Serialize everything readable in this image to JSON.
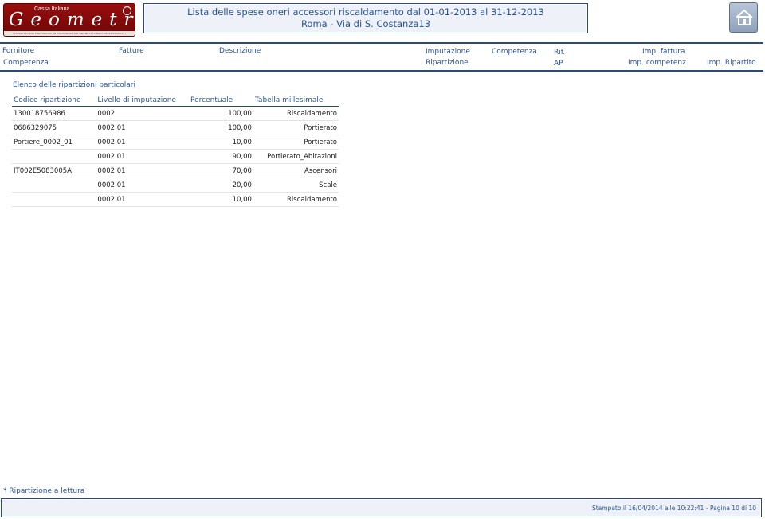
{
  "logo": {
    "top_text": "Cassa Italiana",
    "word": "Geometri",
    "sub_text": "CASSA ITALIANA PREVIDENZA ED ASSISTENZA DEI GEOMETRI LIBERI PROFESSIONISTI"
  },
  "report": {
    "title_line1": "Lista delle spese oneri accessori riscaldamento dal 01-01-2013 al 31-12-2013",
    "title_line2": "Roma - Via di S. Costanza13"
  },
  "columns": {
    "fornitore": "Fornitore",
    "fatture": "Fatture",
    "descrizione": "Descrizione",
    "imputazione": "Imputazione",
    "competenza_top": "Competenza",
    "rif": "Rif.",
    "imp_fattura": "Imp. fattura",
    "competenza_left": "Competenza",
    "ripartizione": "Ripartizione",
    "ap": "AP",
    "imp_competenz": "Imp. competenz",
    "imp_ripartito": "Imp. Ripartito"
  },
  "section": {
    "title": "Elenco delle ripartizioni particolari",
    "headers": [
      "Codice ripartizione",
      "Livello di imputazione",
      "Percentuale",
      "Tabella millesimale"
    ],
    "rows": [
      {
        "codice": "130018756986",
        "livello": "0002",
        "percentuale": "100,00",
        "tabella": "Riscaldamento"
      },
      {
        "codice": "0686329075",
        "livello": "0002 01",
        "percentuale": "100,00",
        "tabella": "Portierato"
      },
      {
        "codice": "Portiere_0002_01",
        "livello": "0002 01",
        "percentuale": "10,00",
        "tabella": "Portierato"
      },
      {
        "codice": "",
        "livello": "0002 01",
        "percentuale": "90,00",
        "tabella": "Portierato_Abitazioni"
      },
      {
        "codice": "IT002E5083005A",
        "livello": "0002 01",
        "percentuale": "70,00",
        "tabella": "Ascensori"
      },
      {
        "codice": "",
        "livello": "0002 01",
        "percentuale": "20,00",
        "tabella": "Scale"
      },
      {
        "codice": "",
        "livello": "0002 01",
        "percentuale": "10,00",
        "tabella": "Riscaldamento"
      }
    ]
  },
  "footer": {
    "note": "* Ripartizione a lettura",
    "stamp": "Stampato il 16/04/2014 alle 10:22:41",
    "separator": " - ",
    "page": "Pagina 10 di 10"
  },
  "colors": {
    "accent": "#2a5599",
    "border": "#2c4a78",
    "logo_red": "#8e0b0b"
  },
  "icons": {
    "home": "home-icon"
  }
}
